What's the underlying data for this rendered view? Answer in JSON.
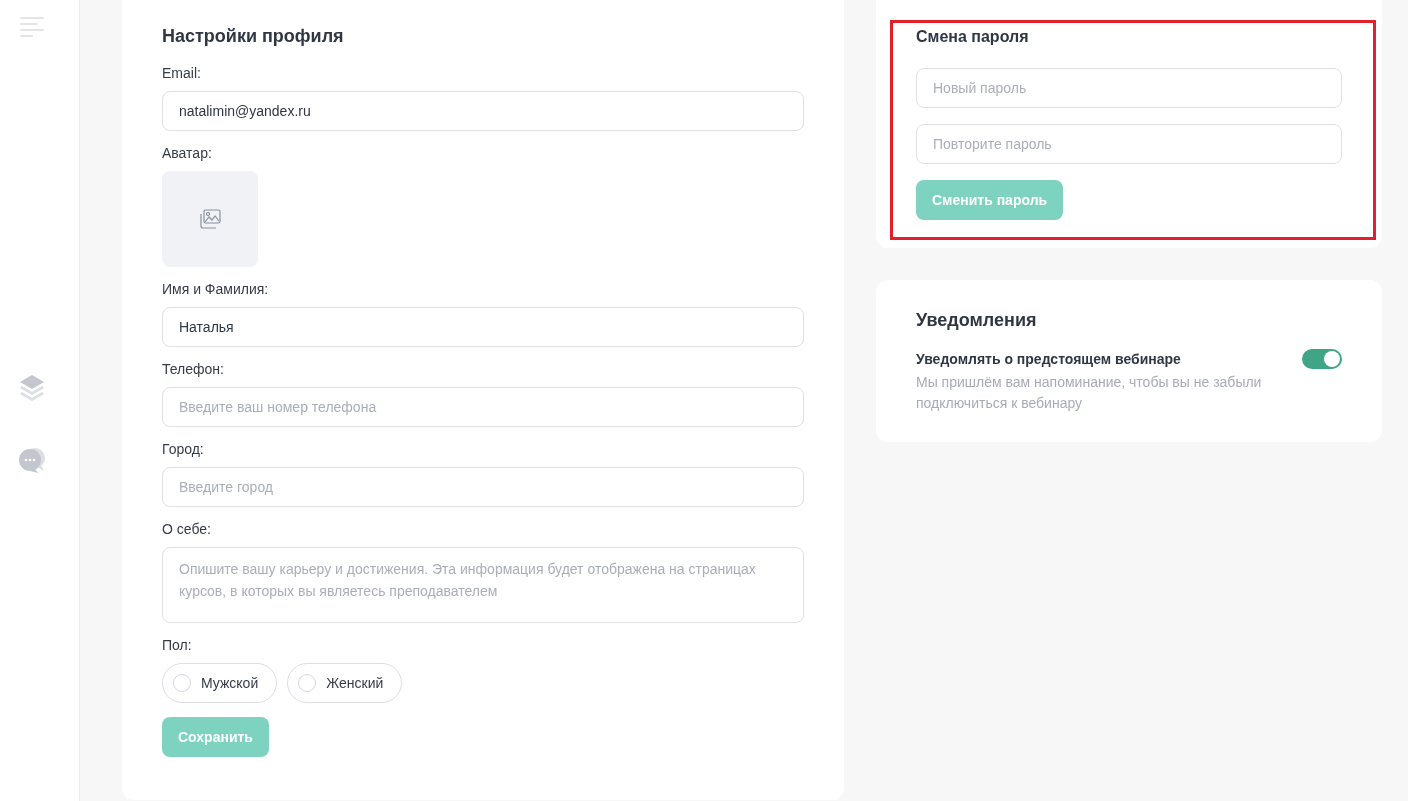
{
  "profile": {
    "title": "Настройки профиля",
    "fields": [
      {
        "kind": "text",
        "label": "Email:",
        "value": "natalimin@yandex.ru"
      },
      {
        "kind": "avatar",
        "label": "Аватар:"
      },
      {
        "kind": "text",
        "label": "Имя и Фамилия:",
        "value": "Наталья"
      },
      {
        "kind": "text",
        "label": "Телефон:",
        "placeholder": "Введите ваш номер телефона"
      },
      {
        "kind": "text",
        "label": "Город:",
        "placeholder": "Введите город"
      },
      {
        "kind": "textarea",
        "label": "О себе:",
        "placeholder": "Опишите вашу карьеру и достижения. Эта информация будет отображена на страницах курсов, в которых вы являетесь преподавателем"
      },
      {
        "kind": "radio",
        "label": "Пол:",
        "options": [
          {
            "label": "Мужской",
            "selected": false
          },
          {
            "label": "Женский",
            "selected": false
          }
        ]
      }
    ],
    "save_button": "Сохранить"
  },
  "password": {
    "title": "Смена пароля",
    "fields": [
      {
        "placeholder": "Новый пароль"
      },
      {
        "placeholder": "Повторите пароль"
      }
    ],
    "button": "Сменить пароль"
  },
  "notifications": {
    "title": "Уведомления",
    "items": [
      {
        "title": "Уведомлять о предстоящем вебинаре",
        "description": "Мы пришлём вам напоминание, чтобы вы не забыли подключиться к вебинару",
        "on": true
      }
    ]
  }
}
